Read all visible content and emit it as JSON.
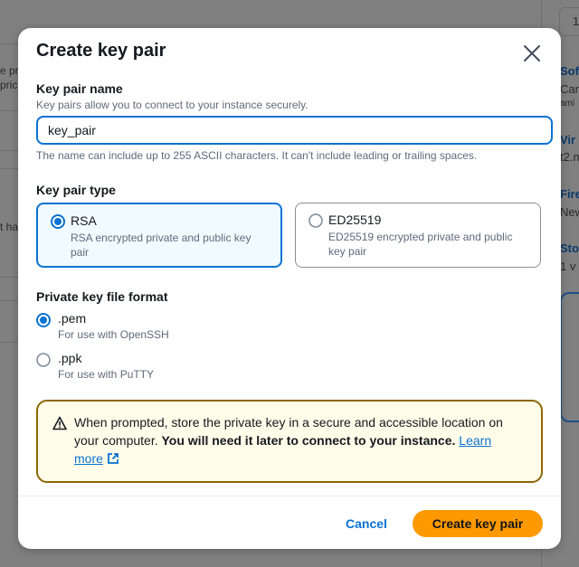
{
  "background": {
    "left_fragments": [
      "e pr",
      "prici",
      "t hav"
    ],
    "right_fragments": [
      {
        "text": "Sof",
        "style": "blue"
      },
      {
        "text": "Can",
        "style": "normal"
      },
      {
        "text": "ami",
        "style": "small"
      },
      {
        "text": "Vir",
        "style": "blue"
      },
      {
        "text": "t2.m",
        "style": "normal"
      },
      {
        "text": "Fire",
        "style": "blue"
      },
      {
        "text": "New",
        "style": "normal"
      },
      {
        "text": "Sto",
        "style": "blue"
      },
      {
        "text": "1 v",
        "style": "normal"
      }
    ],
    "top_right_value": "1"
  },
  "modal": {
    "title": "Create key pair",
    "close_label": "Close",
    "key_pair_name": {
      "label": "Key pair name",
      "description": "Key pairs allow you to connect to your instance securely.",
      "value": "key_pair",
      "hint": "The name can include up to 255 ASCII characters. It can't include leading or trailing spaces."
    },
    "key_pair_type": {
      "label": "Key pair type",
      "options": [
        {
          "title": "RSA",
          "description": "RSA encrypted private and public key pair",
          "selected": true
        },
        {
          "title": "ED25519",
          "description": "ED25519 encrypted private and public key pair",
          "selected": false
        }
      ]
    },
    "file_format": {
      "label": "Private key file format",
      "options": [
        {
          "title": ".pem",
          "description": "For use with OpenSSH",
          "selected": true
        },
        {
          "title": ".ppk",
          "description": "For use with PuTTY",
          "selected": false
        }
      ]
    },
    "alert": {
      "text": "When prompted, store the private key in a secure and accessible location on your computer.",
      "bold_text": "You will need it later to connect to your instance.",
      "link_text": "Learn more"
    },
    "footer": {
      "cancel_label": "Cancel",
      "create_label": "Create key pair"
    }
  },
  "colors": {
    "accent": "#0972d3",
    "primary_button": "#ff9900",
    "warning_border": "#8d6605",
    "warning_bg": "#fffce9",
    "selected_tile_bg": "#f0fbff"
  }
}
